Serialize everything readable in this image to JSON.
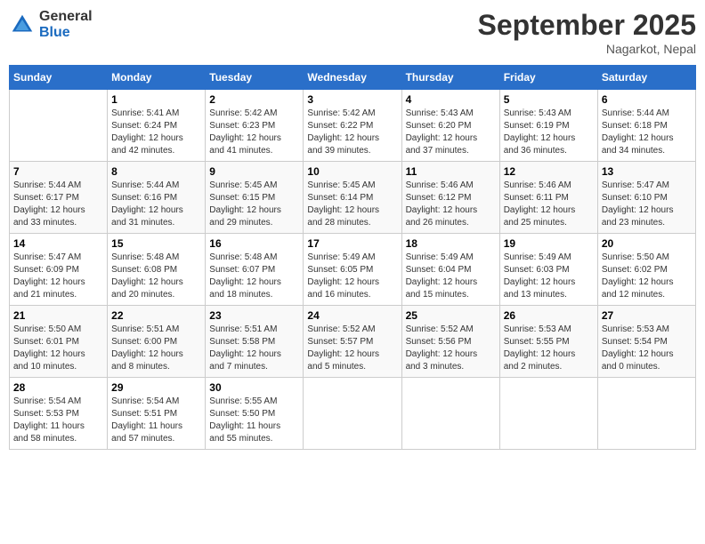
{
  "header": {
    "logo_general": "General",
    "logo_blue": "Blue",
    "month": "September 2025",
    "location": "Nagarkot, Nepal"
  },
  "days_of_week": [
    "Sunday",
    "Monday",
    "Tuesday",
    "Wednesday",
    "Thursday",
    "Friday",
    "Saturday"
  ],
  "weeks": [
    [
      {
        "day": "",
        "info": ""
      },
      {
        "day": "1",
        "info": "Sunrise: 5:41 AM\nSunset: 6:24 PM\nDaylight: 12 hours\nand 42 minutes."
      },
      {
        "day": "2",
        "info": "Sunrise: 5:42 AM\nSunset: 6:23 PM\nDaylight: 12 hours\nand 41 minutes."
      },
      {
        "day": "3",
        "info": "Sunrise: 5:42 AM\nSunset: 6:22 PM\nDaylight: 12 hours\nand 39 minutes."
      },
      {
        "day": "4",
        "info": "Sunrise: 5:43 AM\nSunset: 6:20 PM\nDaylight: 12 hours\nand 37 minutes."
      },
      {
        "day": "5",
        "info": "Sunrise: 5:43 AM\nSunset: 6:19 PM\nDaylight: 12 hours\nand 36 minutes."
      },
      {
        "day": "6",
        "info": "Sunrise: 5:44 AM\nSunset: 6:18 PM\nDaylight: 12 hours\nand 34 minutes."
      }
    ],
    [
      {
        "day": "7",
        "info": "Sunrise: 5:44 AM\nSunset: 6:17 PM\nDaylight: 12 hours\nand 33 minutes."
      },
      {
        "day": "8",
        "info": "Sunrise: 5:44 AM\nSunset: 6:16 PM\nDaylight: 12 hours\nand 31 minutes."
      },
      {
        "day": "9",
        "info": "Sunrise: 5:45 AM\nSunset: 6:15 PM\nDaylight: 12 hours\nand 29 minutes."
      },
      {
        "day": "10",
        "info": "Sunrise: 5:45 AM\nSunset: 6:14 PM\nDaylight: 12 hours\nand 28 minutes."
      },
      {
        "day": "11",
        "info": "Sunrise: 5:46 AM\nSunset: 6:12 PM\nDaylight: 12 hours\nand 26 minutes."
      },
      {
        "day": "12",
        "info": "Sunrise: 5:46 AM\nSunset: 6:11 PM\nDaylight: 12 hours\nand 25 minutes."
      },
      {
        "day": "13",
        "info": "Sunrise: 5:47 AM\nSunset: 6:10 PM\nDaylight: 12 hours\nand 23 minutes."
      }
    ],
    [
      {
        "day": "14",
        "info": "Sunrise: 5:47 AM\nSunset: 6:09 PM\nDaylight: 12 hours\nand 21 minutes."
      },
      {
        "day": "15",
        "info": "Sunrise: 5:48 AM\nSunset: 6:08 PM\nDaylight: 12 hours\nand 20 minutes."
      },
      {
        "day": "16",
        "info": "Sunrise: 5:48 AM\nSunset: 6:07 PM\nDaylight: 12 hours\nand 18 minutes."
      },
      {
        "day": "17",
        "info": "Sunrise: 5:49 AM\nSunset: 6:05 PM\nDaylight: 12 hours\nand 16 minutes."
      },
      {
        "day": "18",
        "info": "Sunrise: 5:49 AM\nSunset: 6:04 PM\nDaylight: 12 hours\nand 15 minutes."
      },
      {
        "day": "19",
        "info": "Sunrise: 5:49 AM\nSunset: 6:03 PM\nDaylight: 12 hours\nand 13 minutes."
      },
      {
        "day": "20",
        "info": "Sunrise: 5:50 AM\nSunset: 6:02 PM\nDaylight: 12 hours\nand 12 minutes."
      }
    ],
    [
      {
        "day": "21",
        "info": "Sunrise: 5:50 AM\nSunset: 6:01 PM\nDaylight: 12 hours\nand 10 minutes."
      },
      {
        "day": "22",
        "info": "Sunrise: 5:51 AM\nSunset: 6:00 PM\nDaylight: 12 hours\nand 8 minutes."
      },
      {
        "day": "23",
        "info": "Sunrise: 5:51 AM\nSunset: 5:58 PM\nDaylight: 12 hours\nand 7 minutes."
      },
      {
        "day": "24",
        "info": "Sunrise: 5:52 AM\nSunset: 5:57 PM\nDaylight: 12 hours\nand 5 minutes."
      },
      {
        "day": "25",
        "info": "Sunrise: 5:52 AM\nSunset: 5:56 PM\nDaylight: 12 hours\nand 3 minutes."
      },
      {
        "day": "26",
        "info": "Sunrise: 5:53 AM\nSunset: 5:55 PM\nDaylight: 12 hours\nand 2 minutes."
      },
      {
        "day": "27",
        "info": "Sunrise: 5:53 AM\nSunset: 5:54 PM\nDaylight: 12 hours\nand 0 minutes."
      }
    ],
    [
      {
        "day": "28",
        "info": "Sunrise: 5:54 AM\nSunset: 5:53 PM\nDaylight: 11 hours\nand 58 minutes."
      },
      {
        "day": "29",
        "info": "Sunrise: 5:54 AM\nSunset: 5:51 PM\nDaylight: 11 hours\nand 57 minutes."
      },
      {
        "day": "30",
        "info": "Sunrise: 5:55 AM\nSunset: 5:50 PM\nDaylight: 11 hours\nand 55 minutes."
      },
      {
        "day": "",
        "info": ""
      },
      {
        "day": "",
        "info": ""
      },
      {
        "day": "",
        "info": ""
      },
      {
        "day": "",
        "info": ""
      }
    ]
  ]
}
